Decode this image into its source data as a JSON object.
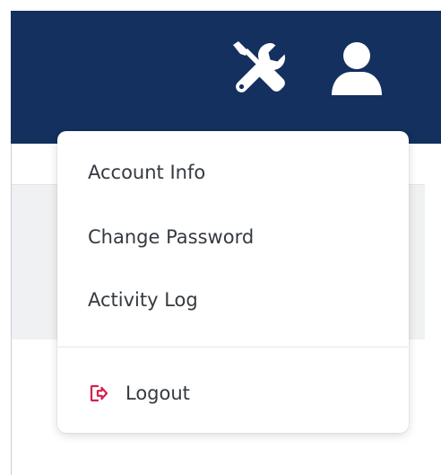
{
  "header": {
    "background_color": "#13305e",
    "tools_icon": "tools-icon",
    "user_icon": "user-icon"
  },
  "user_menu": {
    "items": [
      {
        "label": "Account Info"
      },
      {
        "label": "Change Password"
      },
      {
        "label": "Activity Log"
      }
    ],
    "logout": {
      "label": "Logout",
      "icon": "logout-icon",
      "icon_color": "#d6214a"
    }
  }
}
